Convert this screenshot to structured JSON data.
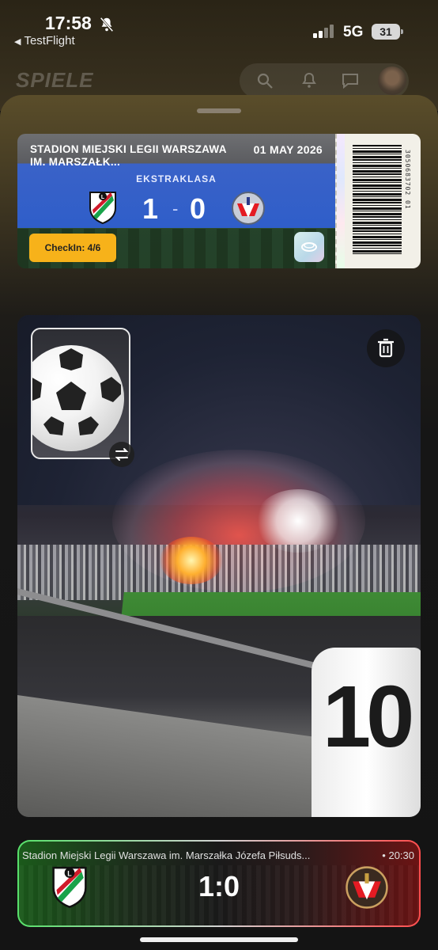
{
  "status_bar": {
    "time": "17:58",
    "back_app": "TestFlight",
    "network": "5G",
    "battery": "31"
  },
  "background_app": {
    "title": "SPIELE"
  },
  "ticket": {
    "venue": "STADION MIEJSKI LEGII WARSZAWA IM. MARSZAŁK...",
    "date": "01 MAY 2026",
    "league": "EKSTRAKLASA",
    "home_score": "1",
    "score_separator": "-",
    "away_score": "0",
    "checkin_label": "CheckIn: 4/6",
    "barcode_number": "3050683702 01"
  },
  "photo": {
    "jersey_number": "10"
  },
  "match_bar": {
    "venue": "Stadion Miejski Legii Warszawa im. Marszałka Józefa Piłsuds...",
    "time": "• 20:30",
    "score": "1:0"
  },
  "colors": {
    "ticket_blue": "#2f5ec9",
    "checkin_yellow": "#f7b21a",
    "home_green": "#57e06a",
    "away_red": "#ff4d4d"
  }
}
